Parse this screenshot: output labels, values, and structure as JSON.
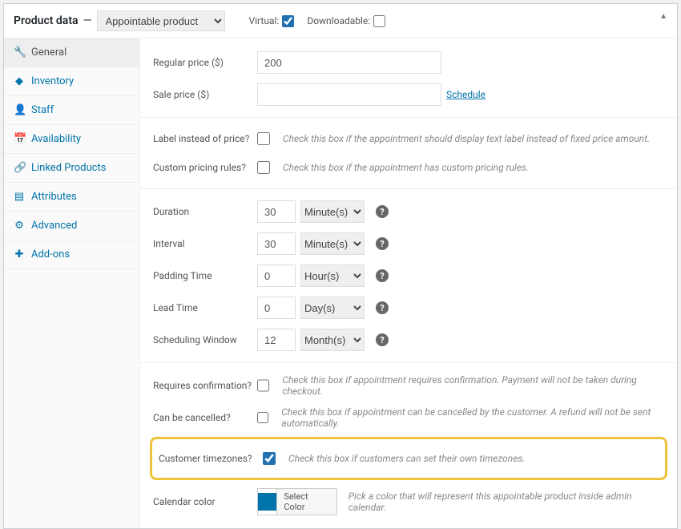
{
  "header": {
    "title": "Product data",
    "product_type": "Appointable product",
    "virtual_label": "Virtual:",
    "virtual_checked": true,
    "downloadable_label": "Downloadable:",
    "downloadable_checked": false
  },
  "sidebar": {
    "items": [
      {
        "label": "General",
        "icon": "🔧"
      },
      {
        "label": "Inventory",
        "icon": "◆"
      },
      {
        "label": "Staff",
        "icon": "👤"
      },
      {
        "label": "Availability",
        "icon": "📅"
      },
      {
        "label": "Linked Products",
        "icon": "🔗"
      },
      {
        "label": "Attributes",
        "icon": "▤"
      },
      {
        "label": "Advanced",
        "icon": "⚙"
      },
      {
        "label": "Add-ons",
        "icon": "✚"
      }
    ],
    "active": 0
  },
  "fields": {
    "regular_price_label": "Regular price ($)",
    "regular_price": "200",
    "sale_price_label": "Sale price ($)",
    "sale_price": "",
    "schedule_link": "Schedule",
    "label_instead_label": "Label instead of price?",
    "label_instead_hint": "Check this box if the appointment should display text label instead of fixed price amount.",
    "custom_pricing_label": "Custom pricing rules?",
    "custom_pricing_hint": "Check this box if the appointment has custom pricing rules.",
    "duration_label": "Duration",
    "duration_value": "30",
    "duration_unit": "Minute(s)",
    "interval_label": "Interval",
    "interval_value": "30",
    "interval_unit": "Minute(s)",
    "padding_label": "Padding Time",
    "padding_value": "0",
    "padding_unit": "Hour(s)",
    "lead_label": "Lead Time",
    "lead_value": "0",
    "lead_unit": "Day(s)",
    "sched_window_label": "Scheduling Window",
    "sched_window_value": "12",
    "sched_window_unit": "Month(s)",
    "requires_conf_label": "Requires confirmation?",
    "requires_conf_hint": "Check this box if appointment requires confirmation. Payment will not be taken during checkout.",
    "cancelled_label": "Can be cancelled?",
    "cancelled_hint": "Check this box if appointment can be cancelled by the customer. A refund will not be sent automatically.",
    "tz_label": "Customer timezones?",
    "tz_checked": true,
    "tz_hint": "Check this box if customers can set their own timezones.",
    "calcolor_label": "Calendar color",
    "calcolor_btn": "Select Color",
    "calcolor_hint": "Pick a color that will represent this appointable product inside admin calendar.",
    "calcolor_swatch": "#0073aa"
  }
}
